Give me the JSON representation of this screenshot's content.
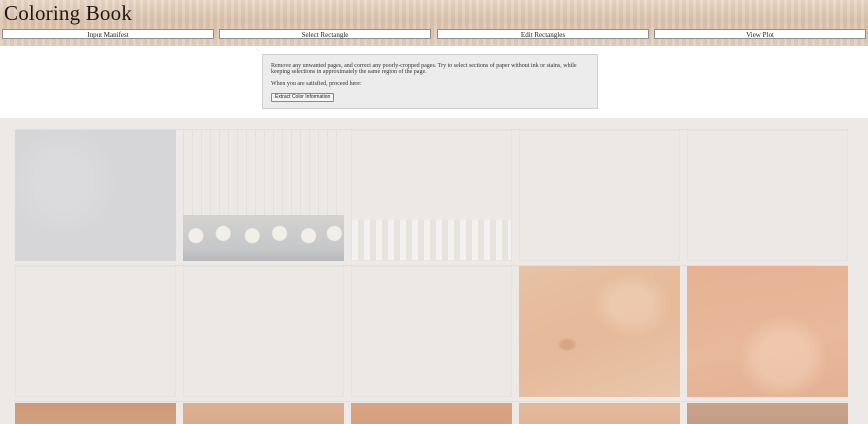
{
  "app": {
    "title": "Coloring Book"
  },
  "nav": {
    "tabs": [
      {
        "label": "Input Manifest"
      },
      {
        "label": "Select Rectangle"
      },
      {
        "label": "Edit Rectangles"
      },
      {
        "label": "View Plot"
      }
    ]
  },
  "instructions": {
    "text": "Remove any unwanted pages, and correct any poorly-cropped pages. Try to select sections of paper without ink or stains, while keeping selections in approximately the same region of the page.",
    "proceed": "When you are satisfied, proceed here:",
    "button_label": "Extract Color Information"
  },
  "colors": {
    "header_bg": "#dcc3ac",
    "gallery_bg": "#ece9e6",
    "thumb_gray": "#d6d6d8",
    "thumb_peach": "#e7c2a4",
    "thumb_orange": "#cf9a76"
  }
}
